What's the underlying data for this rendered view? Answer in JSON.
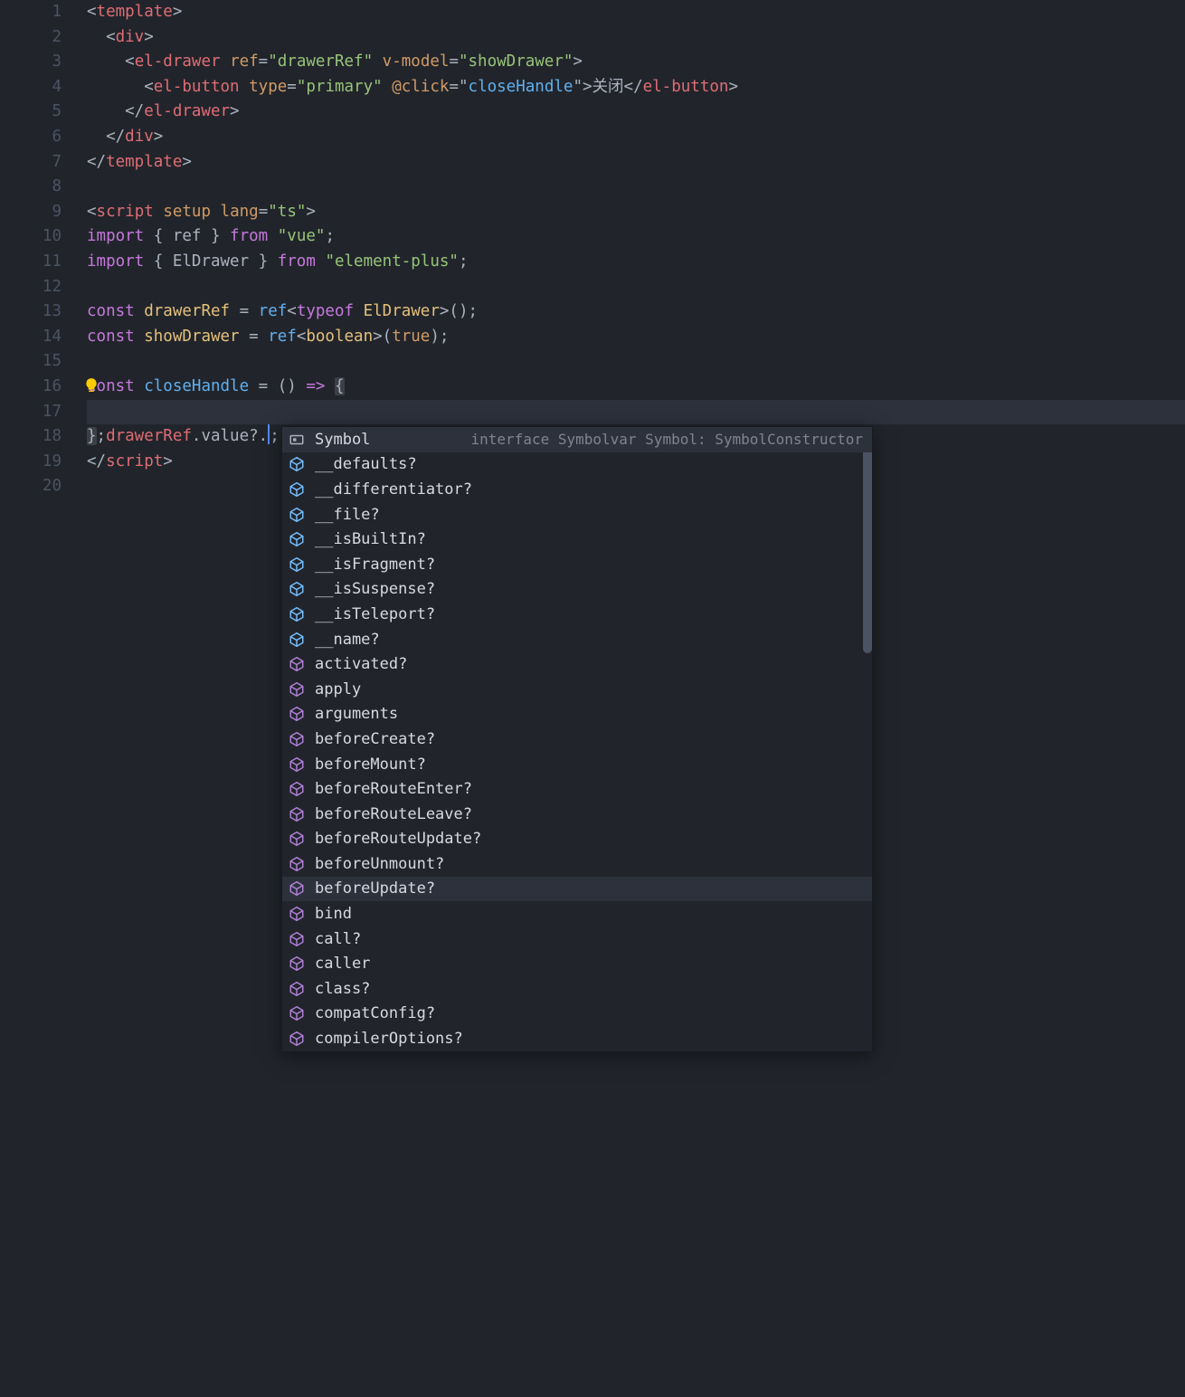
{
  "gutter": {
    "start": 1,
    "end": 20
  },
  "code": {
    "l1": [
      [
        "punc",
        "<"
      ],
      [
        "tag",
        "template"
      ],
      [
        "punc",
        ">"
      ]
    ],
    "l2": [
      [
        "punc",
        "  <"
      ],
      [
        "tag",
        "div"
      ],
      [
        "punc",
        ">"
      ]
    ],
    "l3": [
      [
        "punc",
        "    <"
      ],
      [
        "tag",
        "el-drawer"
      ],
      [
        "punc",
        " "
      ],
      [
        "attr",
        "ref"
      ],
      [
        "punc",
        "="
      ],
      [
        "str",
        "\"drawerRef\""
      ],
      [
        "punc",
        " "
      ],
      [
        "attr",
        "v-model"
      ],
      [
        "punc",
        "="
      ],
      [
        "str",
        "\"showDrawer\""
      ],
      [
        "punc",
        ">"
      ]
    ],
    "l4": [
      [
        "punc",
        "      <"
      ],
      [
        "tag",
        "el-button"
      ],
      [
        "punc",
        " "
      ],
      [
        "attr",
        "type"
      ],
      [
        "punc",
        "="
      ],
      [
        "str",
        "\"primary\""
      ],
      [
        "punc",
        " "
      ],
      [
        "attr",
        "@click"
      ],
      [
        "punc",
        "="
      ],
      [
        "punc",
        "\""
      ],
      [
        "func",
        "closeHandle"
      ],
      [
        "punc",
        "\""
      ],
      [
        "punc",
        ">"
      ],
      [
        "txt",
        "关闭"
      ],
      [
        "punc",
        "</"
      ],
      [
        "tag",
        "el-button"
      ],
      [
        "punc",
        ">"
      ]
    ],
    "l5": [
      [
        "punc",
        "    </"
      ],
      [
        "tag",
        "el-drawer"
      ],
      [
        "punc",
        ">"
      ]
    ],
    "l6": [
      [
        "punc",
        "  </"
      ],
      [
        "tag",
        "div"
      ],
      [
        "punc",
        ">"
      ]
    ],
    "l7": [
      [
        "punc",
        "</"
      ],
      [
        "tag",
        "template"
      ],
      [
        "punc",
        ">"
      ]
    ],
    "l8": [],
    "l9": [
      [
        "punc",
        "<"
      ],
      [
        "tag",
        "script"
      ],
      [
        "punc",
        " "
      ],
      [
        "attr",
        "setup"
      ],
      [
        "punc",
        " "
      ],
      [
        "attr",
        "lang"
      ],
      [
        "punc",
        "="
      ],
      [
        "str",
        "\"ts\""
      ],
      [
        "punc",
        ">"
      ]
    ],
    "l10": [
      [
        "kw",
        "import"
      ],
      [
        "punc",
        " { "
      ],
      [
        "ident",
        "ref"
      ],
      [
        "punc",
        " } "
      ],
      [
        "kw",
        "from"
      ],
      [
        "punc",
        " "
      ],
      [
        "str",
        "\"vue\""
      ],
      [
        "punc",
        ";"
      ]
    ],
    "l11": [
      [
        "kw",
        "import"
      ],
      [
        "punc",
        " { "
      ],
      [
        "ident",
        "ElDrawer"
      ],
      [
        "punc",
        " } "
      ],
      [
        "kw",
        "from"
      ],
      [
        "punc",
        " "
      ],
      [
        "str",
        "\"element-plus\""
      ],
      [
        "punc",
        ";"
      ]
    ],
    "l12": [],
    "l13": [
      [
        "kw",
        "const"
      ],
      [
        "punc",
        " "
      ],
      [
        "var",
        "drawerRef"
      ],
      [
        "punc",
        " = "
      ],
      [
        "func",
        "ref"
      ],
      [
        "punc",
        "<"
      ],
      [
        "kw",
        "typeof"
      ],
      [
        "punc",
        " "
      ],
      [
        "type",
        "ElDrawer"
      ],
      [
        "punc",
        ">();"
      ]
    ],
    "l14": [
      [
        "kw",
        "const"
      ],
      [
        "punc",
        " "
      ],
      [
        "var",
        "showDrawer"
      ],
      [
        "punc",
        " = "
      ],
      [
        "func",
        "ref"
      ],
      [
        "punc",
        "<"
      ],
      [
        "type",
        "boolean"
      ],
      [
        "punc",
        ">("
      ],
      [
        "bool",
        "true"
      ],
      [
        "punc",
        ");"
      ]
    ],
    "l15": [],
    "l16": [
      [
        "kw",
        "const"
      ],
      [
        "punc",
        " "
      ],
      [
        "func",
        "closeHandle"
      ],
      [
        "punc",
        " = () "
      ],
      [
        "kw",
        "=>"
      ],
      [
        "punc",
        " "
      ],
      [
        "brak",
        "{"
      ]
    ],
    "l17": [
      [
        "punc",
        "  "
      ],
      [
        "varc",
        "drawerRef"
      ],
      [
        "punc",
        "."
      ],
      [
        "ident",
        "value"
      ],
      [
        "punc",
        "?."
      ],
      [
        "cursor",
        ""
      ],
      [
        "punc",
        ";"
      ]
    ],
    "l18": [
      [
        "brak",
        "}"
      ],
      [
        "punc",
        ";"
      ]
    ],
    "l19": [
      [
        "punc",
        "</"
      ],
      [
        "tag",
        "script"
      ],
      [
        "punc",
        ">"
      ]
    ],
    "l20": []
  },
  "current_line": 17,
  "bulb_line": 16,
  "autocomplete": {
    "detail_for_selected": "interface Symbolvar Symbol: SymbolConstructor",
    "selected_index": 0,
    "hover_index": 18,
    "items": [
      {
        "icon": "interface",
        "label": "Symbol"
      },
      {
        "icon": "field",
        "label": "__defaults?"
      },
      {
        "icon": "field",
        "label": "__differentiator?"
      },
      {
        "icon": "field",
        "label": "__file?"
      },
      {
        "icon": "field",
        "label": "__isBuiltIn?"
      },
      {
        "icon": "field",
        "label": "__isFragment?"
      },
      {
        "icon": "field",
        "label": "__isSuspense?"
      },
      {
        "icon": "field",
        "label": "__isTeleport?"
      },
      {
        "icon": "field",
        "label": "__name?"
      },
      {
        "icon": "method",
        "label": "activated?"
      },
      {
        "icon": "method",
        "label": "apply"
      },
      {
        "icon": "method",
        "label": "arguments"
      },
      {
        "icon": "method",
        "label": "beforeCreate?"
      },
      {
        "icon": "method",
        "label": "beforeMount?"
      },
      {
        "icon": "method",
        "label": "beforeRouteEnter?"
      },
      {
        "icon": "method",
        "label": "beforeRouteLeave?"
      },
      {
        "icon": "method",
        "label": "beforeRouteUpdate?"
      },
      {
        "icon": "method",
        "label": "beforeUnmount?"
      },
      {
        "icon": "method",
        "label": "beforeUpdate?"
      },
      {
        "icon": "method",
        "label": "bind"
      },
      {
        "icon": "method",
        "label": "call?"
      },
      {
        "icon": "method",
        "label": "caller"
      },
      {
        "icon": "method",
        "label": "class?"
      },
      {
        "icon": "method",
        "label": "compatConfig?"
      },
      {
        "icon": "method",
        "label": "compilerOptions?"
      }
    ]
  },
  "icons": {
    "interface_color": "#abb2bf",
    "field_color": "#75beff",
    "method_color": "#b180d7"
  }
}
